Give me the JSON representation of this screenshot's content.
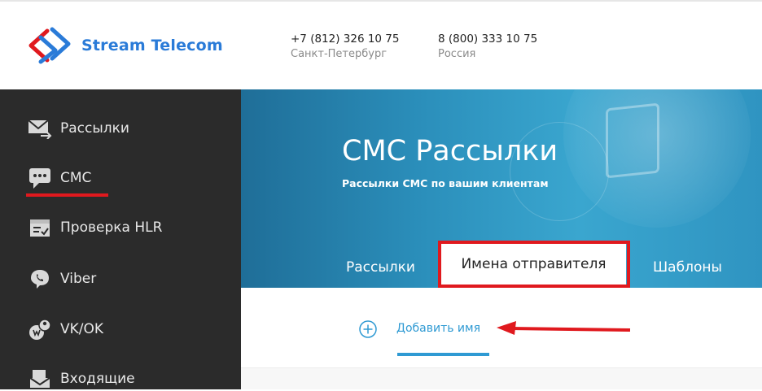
{
  "brand": {
    "name": "Stream Telecom",
    "accent": "#2a7bd8",
    "logo_colors": [
      "#e0191e",
      "#2a7bd8"
    ]
  },
  "contacts": [
    {
      "phone": "+7 (812) 326 10 75",
      "city": "Санкт-Петербург"
    },
    {
      "phone": "8 (800) 333 10 75",
      "city": "Россия"
    }
  ],
  "sidebar": {
    "items": [
      {
        "label": "Рассылки",
        "icon": "envelope-icon"
      },
      {
        "label": "СМС",
        "icon": "sms-chat-icon",
        "active": true
      },
      {
        "label": "Проверка HLR",
        "icon": "calendar-check-icon"
      },
      {
        "label": "Viber",
        "icon": "viber-icon"
      },
      {
        "label": "VK/OK",
        "icon": "social-icon"
      },
      {
        "label": "Входящие",
        "icon": "inbox-icon"
      }
    ],
    "active_color": "#e0191e"
  },
  "hero": {
    "title": "СМС Рассылки",
    "subtitle": "Рассылки СМС по вашим клиентам"
  },
  "tabs": [
    {
      "label": "Рассылки"
    },
    {
      "label": "Имена отправителя",
      "active": true
    },
    {
      "label": "Шаблоны"
    }
  ],
  "actions": {
    "add_name": "Добавить имя",
    "link_color": "#2f9ad3"
  },
  "annotation": {
    "highlight_color": "#e0191e"
  }
}
